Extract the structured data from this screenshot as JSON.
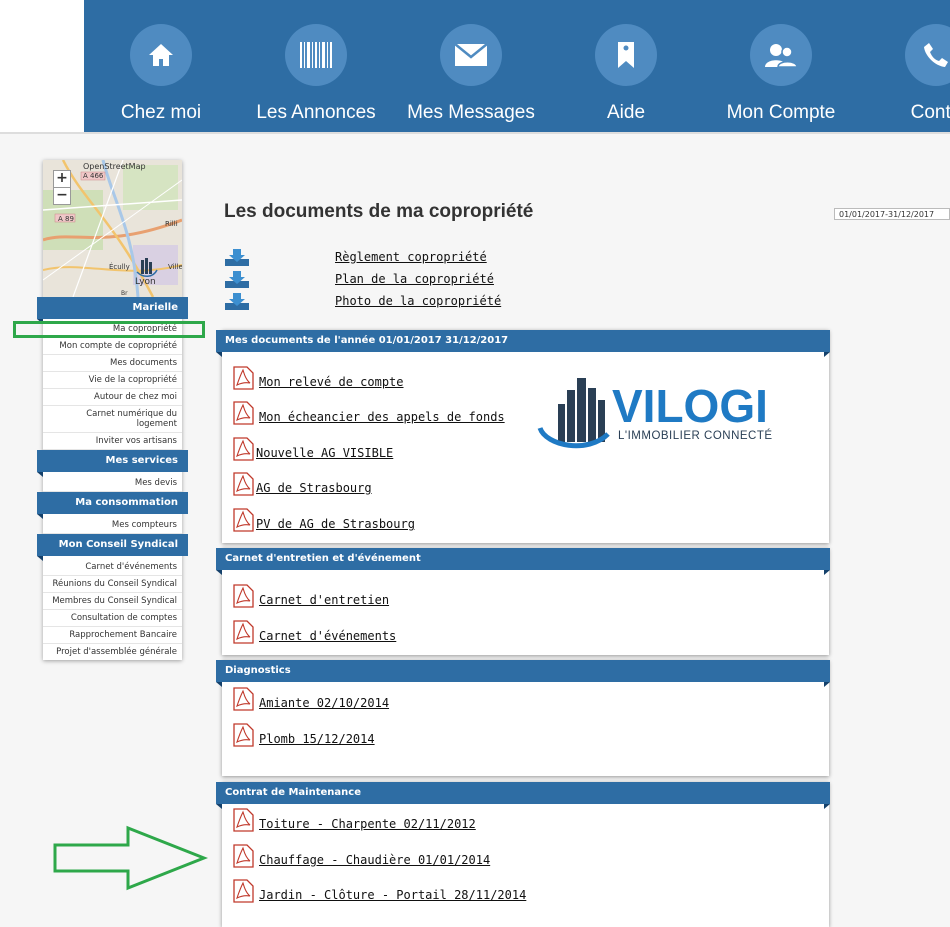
{
  "nav": {
    "items": [
      {
        "label": "Chez moi",
        "icon": "home-icon"
      },
      {
        "label": "Les Annonces",
        "icon": "barcode-icon"
      },
      {
        "label": "Mes Messages",
        "icon": "envelope-icon"
      },
      {
        "label": "Aide",
        "icon": "bookmark-icon"
      },
      {
        "label": "Mon Compte",
        "icon": "users-icon"
      },
      {
        "label": "Conta",
        "icon": "phone-icon"
      }
    ]
  },
  "map": {
    "attribution": "OpenStreetMap",
    "road1": "A 466",
    "road2": "A 89",
    "town1": "Écully",
    "town2": "Lyon",
    "town3": "Rilli",
    "town4": "Villeu",
    "town5": "Br"
  },
  "sidebar": {
    "user_head": "Marielle",
    "user_links": [
      "Ma copropriété",
      "Mon compte de copropriété",
      "Mes documents",
      "Vie de la copropriété",
      "Autour de chez moi",
      "Carnet numérique du logement",
      "Inviter vos artisans"
    ],
    "services_head": "Mes services",
    "services_links": [
      "Mes devis"
    ],
    "conso_head": "Ma consommation",
    "conso_links": [
      "Mes compteurs"
    ],
    "conseil_head": "Mon Conseil Syndical",
    "conseil_links": [
      "Carnet d'événements",
      "Réunions du Conseil Syndical",
      "Membres du Conseil Syndical",
      "Consultation de comptes",
      "Rapprochement Bancaire",
      "Projet d'assemblée générale"
    ]
  },
  "page": {
    "title": "Les documents de ma copropriété",
    "date_range": "01/01/2017-31/12/2017",
    "top_docs": [
      "Règlement copropriété",
      "Plan de la copropriété",
      "Photo de la copropriété"
    ]
  },
  "panels": {
    "annee": {
      "title": "Mes documents de l'année 01/01/2017 31/12/2017",
      "docs": [
        "Mon relevé de compte",
        "Mon écheancier des appels de fonds ",
        "Nouvelle AG VISIBLE",
        "AG de Strasbourg",
        "PV de AG de Strasbourg"
      ]
    },
    "carnet": {
      "title": "Carnet d'entretien et d'événement",
      "docs": [
        "Carnet d'entretien",
        "Carnet d'événements"
      ]
    },
    "diag": {
      "title": "Diagnostics",
      "docs": [
        "Amiante 02/10/2014",
        "Plomb 15/12/2014"
      ]
    },
    "maint": {
      "title": "Contrat de Maintenance",
      "docs": [
        "Toiture - Charpente 02/11/2012",
        "Chauffage - Chaudière 01/01/2014",
        "Jardin - Clôture - Portail 28/11/2014"
      ]
    }
  },
  "logo": {
    "name": "VILOGI",
    "tagline": "L'IMMOBILIER CONNECTÉ"
  },
  "colors": {
    "nav_blue": "#2e6da4",
    "highlight_green": "#2ea84a"
  }
}
